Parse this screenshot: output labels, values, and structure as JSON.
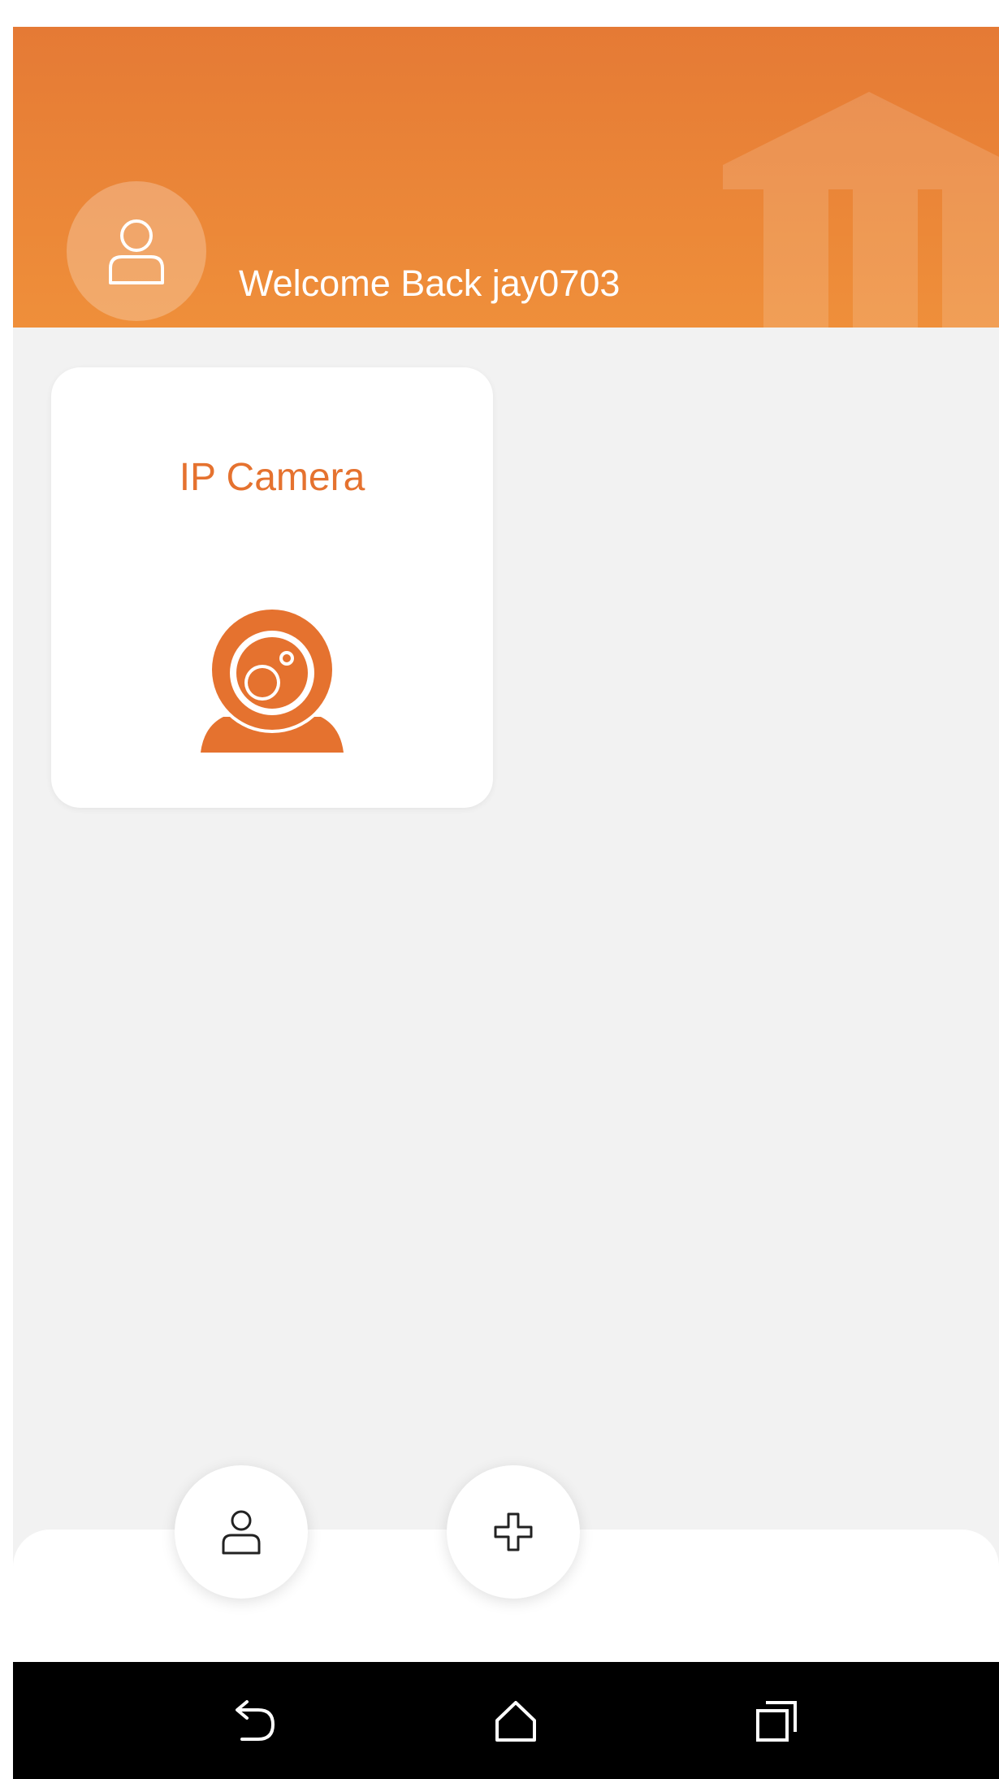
{
  "header": {
    "welcome_text": "Welcome Back jay0703",
    "avatar_icon": "user-icon",
    "watermark_icon": "house-logo-icon"
  },
  "devices": [
    {
      "label": "IP Camera",
      "icon": "webcam-icon"
    }
  ],
  "bottom_bar": {
    "profile_icon": "user-icon",
    "add_icon": "plus-icon"
  },
  "system_nav": {
    "back_icon": "back-icon",
    "home_icon": "home-icon",
    "recent_icon": "recent-apps-icon"
  },
  "colors": {
    "accent": "#e5722f",
    "header_top": "#e57a35",
    "header_bottom": "#ef8f3a",
    "background": "#f2f2f2",
    "navbar": "#000000"
  }
}
